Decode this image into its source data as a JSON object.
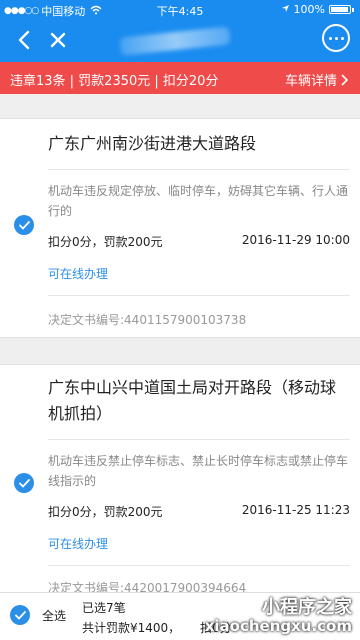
{
  "status_bar": {
    "carrier": "中国移动",
    "time": "下午4:45",
    "battery_pct": "100%"
  },
  "summary": {
    "text": "违章13条 | 罚款2350元 | 扣分20分",
    "link": "车辆详情"
  },
  "violations": [
    {
      "location": "广东广州南沙街进港大道路段",
      "description": "机动车违反规定停放、临时停车，妨碍其它车辆、行人通行的",
      "points_fine": "扣分0分，罚款200元",
      "datetime": "2016-11-29 10:00",
      "action": "可在线办理",
      "doc_no": "决定文书编号:4401157900103738"
    },
    {
      "location": "广东中山兴中道国土局对开路段（移动球机抓拍）",
      "description": "机动车违反禁止停车标志、禁止长时停车标志或禁止停车线指示的",
      "points_fine": "扣分0分，罚款200元",
      "datetime": "2016-11-25 11:23",
      "action": "可在线办理",
      "doc_no": "决定文书编号:4420017900394664"
    }
  ],
  "bottom_bar": {
    "select_all": "全选",
    "selected": "已选7笔",
    "total": "共计罚款¥1400，",
    "points": "扣0分"
  },
  "watermark": {
    "line1": "小程序之家",
    "line2": "xiaochengxu.com"
  },
  "colors": {
    "header": "#1a8cf0",
    "summary": "#ef4b4b",
    "accent": "#2b8fe8"
  }
}
